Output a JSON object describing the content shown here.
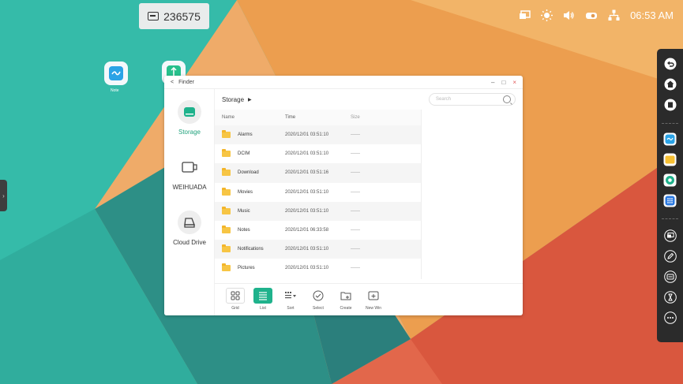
{
  "top_code": {
    "value": "236575",
    "icon": "screen-code-icon"
  },
  "status_bar": {
    "time": "06:53 AM",
    "icons": [
      "screen-share-icon",
      "brightness-icon",
      "volume-icon",
      "camera-icon",
      "network-icon"
    ]
  },
  "desktop_icons": [
    {
      "label": "Note",
      "icon": "note-app-icon"
    },
    {
      "label": "",
      "icon": "finder-app-icon"
    }
  ],
  "finder": {
    "back_label": "<",
    "title": "Finder",
    "window_controls": [
      "–",
      "□",
      "×"
    ],
    "sidebar": [
      {
        "label": "Storage",
        "icon": "storage-drive-icon",
        "active": true
      },
      {
        "label": "WEIHUADA",
        "icon": "usb-drive-icon",
        "active": false
      },
      {
        "label": "Cloud Drive",
        "icon": "cloud-drive-icon",
        "active": false
      }
    ],
    "breadcrumb": "Storage",
    "search_placeholder": "Search",
    "columns": {
      "name": "Name",
      "time": "Time",
      "size": "Size"
    },
    "rows": [
      {
        "name": "Alarms",
        "time": "2020/12/01 03:51:10",
        "size": "——"
      },
      {
        "name": "DCIM",
        "time": "2020/12/01 03:51:10",
        "size": "——"
      },
      {
        "name": "Download",
        "time": "2020/12/01 03:51:16",
        "size": "——"
      },
      {
        "name": "Movies",
        "time": "2020/12/01 03:51:10",
        "size": "——"
      },
      {
        "name": "Music",
        "time": "2020/12/01 03:51:10",
        "size": "——"
      },
      {
        "name": "Notes",
        "time": "2020/12/01 06:33:58",
        "size": "——"
      },
      {
        "name": "Notifications",
        "time": "2020/12/01 03:51:10",
        "size": "——"
      },
      {
        "name": "Pictures",
        "time": "2020/12/01 03:51:10",
        "size": "——"
      }
    ],
    "toolbar": [
      {
        "label": "Grid",
        "icon": "grid-view-icon",
        "active": false
      },
      {
        "label": "List",
        "icon": "list-view-icon",
        "active": true
      },
      {
        "label": "Sort",
        "icon": "sort-icon",
        "active": false
      },
      {
        "label": "Select",
        "icon": "select-check-icon",
        "active": false
      },
      {
        "label": "Create",
        "icon": "create-folder-icon",
        "active": false
      },
      {
        "label": "New Win",
        "icon": "new-window-icon",
        "active": false
      }
    ]
  },
  "dock": {
    "items": [
      "back-icon",
      "home-icon",
      "recent-apps-icon",
      "note-app-icon",
      "finder-app-icon",
      "browser-icon",
      "apps-grid-icon",
      "screen-share-icon",
      "annotate-icon",
      "screen-code-icon",
      "timer-icon",
      "more-icon"
    ]
  },
  "colors": {
    "accent": "#1fb28c",
    "folder": "#f7c544",
    "dock": "#2b2b2b"
  }
}
